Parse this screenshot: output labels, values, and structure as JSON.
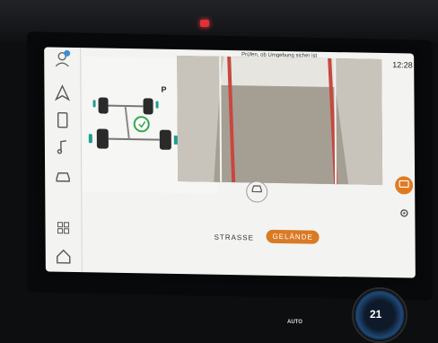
{
  "header": {
    "banner": "Prüfen, ob Umgebung sicher ist",
    "clock": "12:28"
  },
  "vehicle": {
    "gear": "P"
  },
  "sidebar": {
    "items": [
      {
        "icon": "navigation-icon"
      },
      {
        "icon": "phone-icon"
      },
      {
        "icon": "music-icon"
      },
      {
        "icon": "car-icon"
      },
      {
        "icon": "apps-grid-icon"
      },
      {
        "icon": "home-icon"
      }
    ]
  },
  "modes": {
    "street": "STRASSE",
    "offroad": "GELÄNDE",
    "active": "offroad"
  },
  "console": {
    "auto_label": "AUTO",
    "climate_value": "21"
  },
  "colors": {
    "accent": "#d97a24",
    "screen_bg": "#f3f3f1",
    "tire_indicator": "#1f9e8a"
  }
}
